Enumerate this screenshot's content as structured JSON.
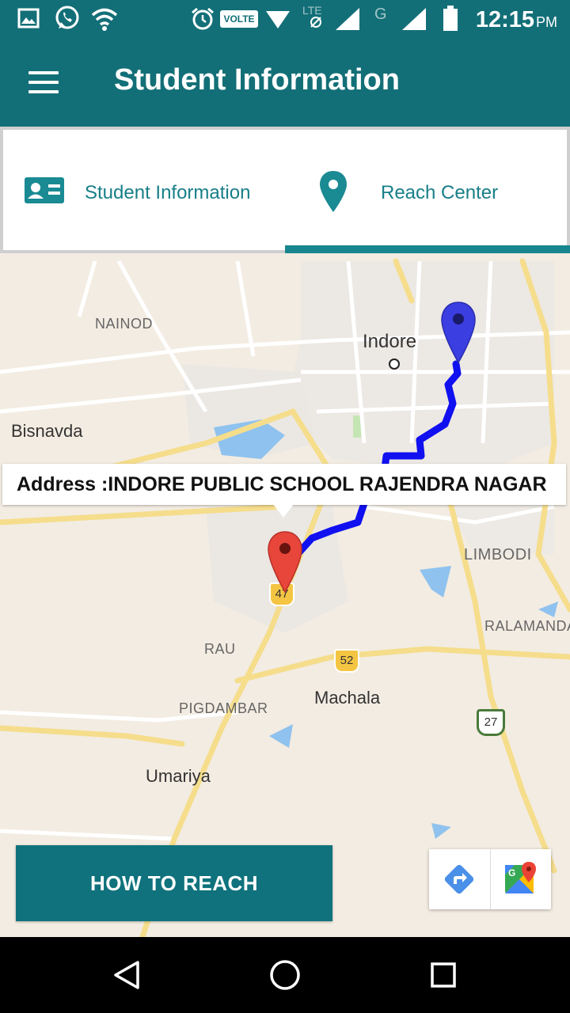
{
  "status_bar": {
    "time": "12:15",
    "ampm": "PM",
    "volte": "VOLTE",
    "icons": [
      "gallery-icon",
      "whatsapp-icon",
      "wifi-icon",
      "alarm-icon",
      "volte-icon",
      "signal-icon",
      "lte-icon",
      "signal-icon",
      "g-network-icon",
      "signal-icon",
      "battery-icon"
    ]
  },
  "app_bar": {
    "title": "Student Information",
    "menu_icon": "hamburger-icon"
  },
  "tabs": [
    {
      "label": "Student Information",
      "icon": "id-card-icon",
      "selected": false
    },
    {
      "label": "Reach Center",
      "icon": "location-pin-icon",
      "selected": true
    }
  ],
  "map": {
    "labels": {
      "nainod": "NAINOD",
      "indore": "Indore",
      "bisnavda": "Bisnavda",
      "limbodi": "LIMBODI",
      "ralamanda": "RALAMANDA",
      "rau": "RAU",
      "machala": "Machala",
      "pigdambar": "PIGDAMBAR",
      "umariya": "Umariya"
    },
    "road_shields": [
      "47",
      "52",
      "27"
    ],
    "info_window": "Address :INDORE PUBLIC SCHOOL RAJENDRA NAGAR",
    "colors": {
      "route": "#1010f0",
      "origin_marker": "#3b3ee0",
      "destination_marker": "#e8463a",
      "map_background": "#f3ece2",
      "water": "#8fc2ee",
      "road_highway": "#f5dd8c"
    }
  },
  "how_to_reach": "HOW TO REACH",
  "map_tools": [
    "directions-icon",
    "google-maps-icon"
  ],
  "nav_bar": [
    "back-icon",
    "home-icon",
    "recents-icon"
  ],
  "theme": {
    "primary": "#136f77",
    "accent": "#17868f"
  }
}
